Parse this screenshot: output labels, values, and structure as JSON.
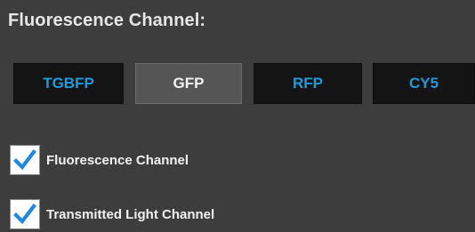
{
  "section": {
    "title": "Fluorescence Channel:"
  },
  "channels": [
    {
      "label": "TGBFP",
      "selected": false
    },
    {
      "label": "GFP",
      "selected": true
    },
    {
      "label": "RFP",
      "selected": false
    },
    {
      "label": "CY5",
      "selected": false
    }
  ],
  "checkboxes": {
    "fluorescence": {
      "label": "Fluorescence Channel",
      "checked": true
    },
    "transmitted": {
      "label": "Transmitted Light Channel",
      "checked": true
    }
  },
  "colors": {
    "background": "#3d3d3d",
    "button_off": "#141414",
    "button_on": "#555555",
    "accent_blue": "#1f9bdc",
    "checkmark": "#1e88e5"
  },
  "icons": {
    "check": "checkmark-icon"
  }
}
